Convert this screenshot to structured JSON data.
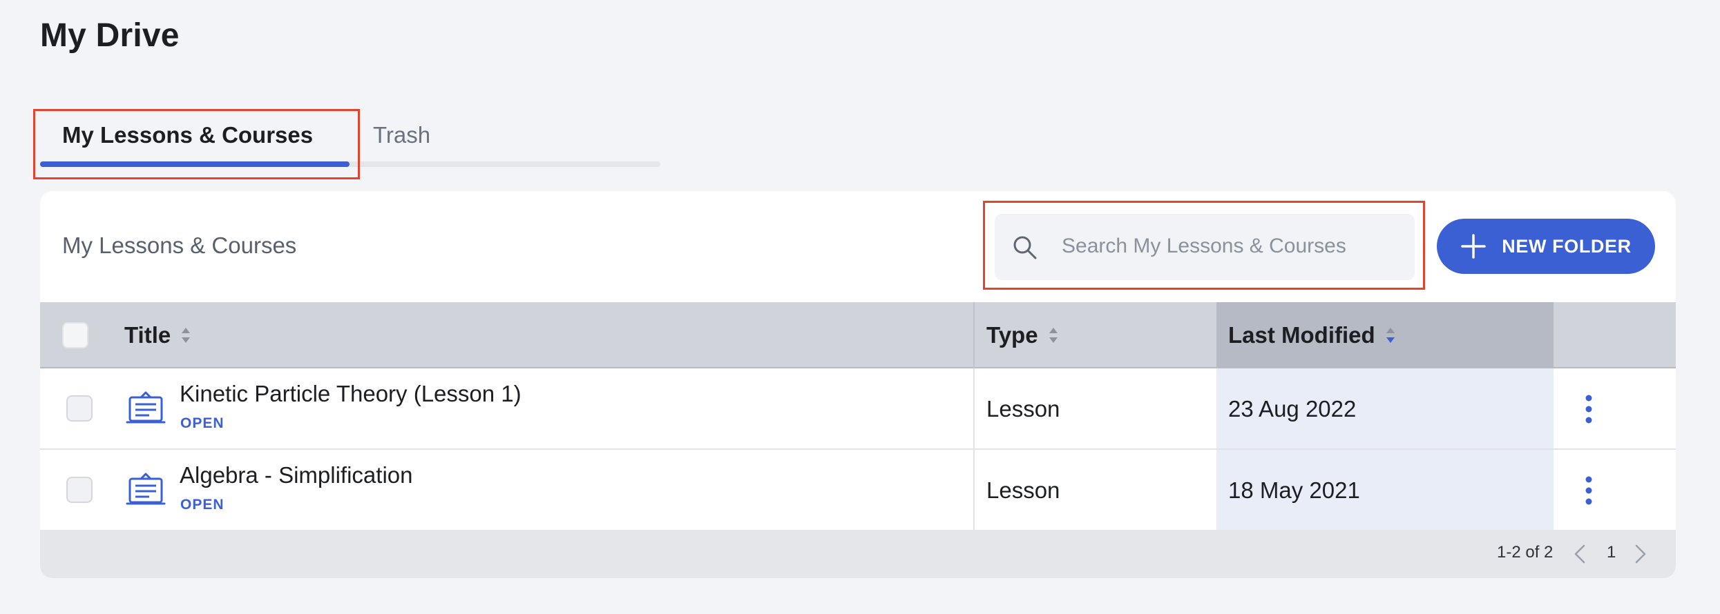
{
  "page": {
    "title": "My Drive"
  },
  "tabs": [
    {
      "label": "My Lessons & Courses",
      "active": true
    },
    {
      "label": "Trash",
      "active": false
    }
  ],
  "panel": {
    "title": "My Lessons & Courses",
    "search_placeholder": "Search My Lessons & Courses",
    "new_folder_label": "NEW FOLDER"
  },
  "table": {
    "columns": [
      "Title",
      "Type",
      "Last Modified"
    ],
    "sorted_by": "Last Modified",
    "rows": [
      {
        "title": "Kinetic Particle Theory (Lesson 1)",
        "action": "OPEN",
        "type": "Lesson",
        "modified": "23 Aug 2022"
      },
      {
        "title": "Algebra - Simplification",
        "action": "OPEN",
        "type": "Lesson",
        "modified": "18 May 2021"
      }
    ]
  },
  "pagination": {
    "range": "1-2 of 2",
    "page": "1"
  },
  "icons": {
    "search": "search-icon",
    "add": "plus-icon",
    "lesson": "lesson-board-icon",
    "more": "kebab-icon",
    "prev": "chevron-left-icon",
    "next": "chevron-right-icon"
  },
  "colors": {
    "accent": "#3a60d4",
    "highlight": "#e2452d",
    "background": "#f3f4f7"
  }
}
